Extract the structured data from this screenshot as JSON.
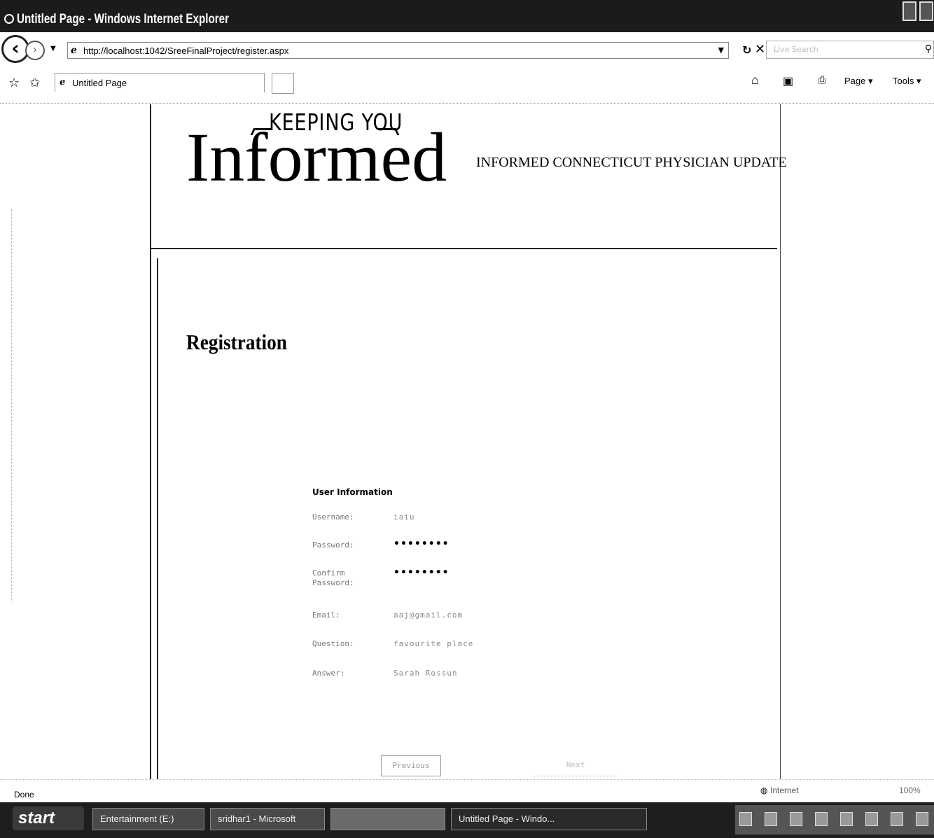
{
  "window": {
    "title": "Untitled Page - Windows Internet Explorer"
  },
  "nav": {
    "address_url": "http://localhost:1042/SreeFinalProject/register.aspx",
    "search_placeholder": "Live Search"
  },
  "tabs": [
    {
      "label": "Untitled Page"
    }
  ],
  "command_bar": {
    "page_label": "Page ▾",
    "tools_label": "Tools ▾"
  },
  "page": {
    "banner_small": "KEEPING YOU",
    "banner_large": "Informed",
    "tagline": "INFORMED CONNECTICUT PHYSICIAN UPDATE",
    "heading": "Registration",
    "form": {
      "title": "User Information",
      "fields": [
        {
          "label": "Username:",
          "value": "iaiu"
        },
        {
          "label": "Password:",
          "value": "••••••••"
        },
        {
          "label": "Confirm Password:",
          "value": "••••••••"
        },
        {
          "label": "Email:",
          "value": "aaj@gmail.com"
        },
        {
          "label": "Question:",
          "value": "favourite place"
        },
        {
          "label": "Answer:",
          "value": "Sarah Rossun"
        }
      ]
    },
    "buttons": {
      "previous": "Previous",
      "next": "Next"
    }
  },
  "status": {
    "text": "Done",
    "zone": "Internet",
    "zoom": "100%"
  },
  "taskbar": {
    "start": "start",
    "tasks": [
      "Entertainment (E:)",
      "sridhar1 - Microsoft",
      "",
      "Untitled Page - Windo..."
    ]
  }
}
